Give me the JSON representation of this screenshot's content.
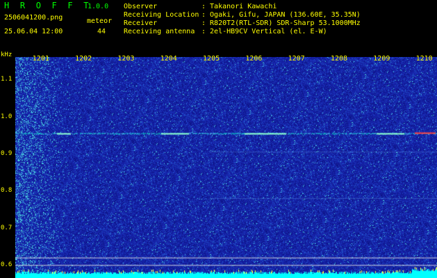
{
  "app": {
    "title": "H R O F F T",
    "version": "1.0.0"
  },
  "file": {
    "name": "2506041200.png",
    "datetime": "25.06.04 12:00"
  },
  "meteor": {
    "label": "meteor",
    "count": "44"
  },
  "info": [
    {
      "label": "Observer",
      "value": ": Takanori Kawachi"
    },
    {
      "label": "Receiving Location",
      "value": ": Ogaki, Gifu, JAPAN (136.60E, 35.35N)"
    },
    {
      "label": "Receiver",
      "value": ": R820T2(RTL-SDR) SDR-Sharp 53.1000MHz"
    },
    {
      "label": "Receiving antenna",
      "value": ": 2el-HB9CV Vertical (el. E-W)"
    }
  ],
  "y_axis": {
    "unit": "kHz",
    "ticks": [
      "1.1",
      "1.0",
      "0.9",
      "0.8",
      "0.7",
      "0.6"
    ],
    "tick_values": [
      1.1,
      1.0,
      0.9,
      0.8,
      0.7,
      0.6
    ],
    "min": 0.565,
    "max": 1.16
  },
  "x_axis": {
    "ticks": [
      "1201",
      "1202",
      "1203",
      "1204",
      "1205",
      "1206",
      "1207",
      "1208",
      "1209",
      "1210"
    ],
    "tick_values": [
      1201,
      1202,
      1203,
      1204,
      1205,
      1206,
      1207,
      1208,
      1209,
      1210
    ],
    "min": 1200.4,
    "max": 1210.3
  },
  "colors": {
    "background": "#000000",
    "title": "#00ff00",
    "text": "#ffff00",
    "spectrum_base": "#141fa3",
    "signal_line": "#00ffcc",
    "strong_signal": "#ff4040",
    "bottom_bar": "#00ffff"
  }
}
